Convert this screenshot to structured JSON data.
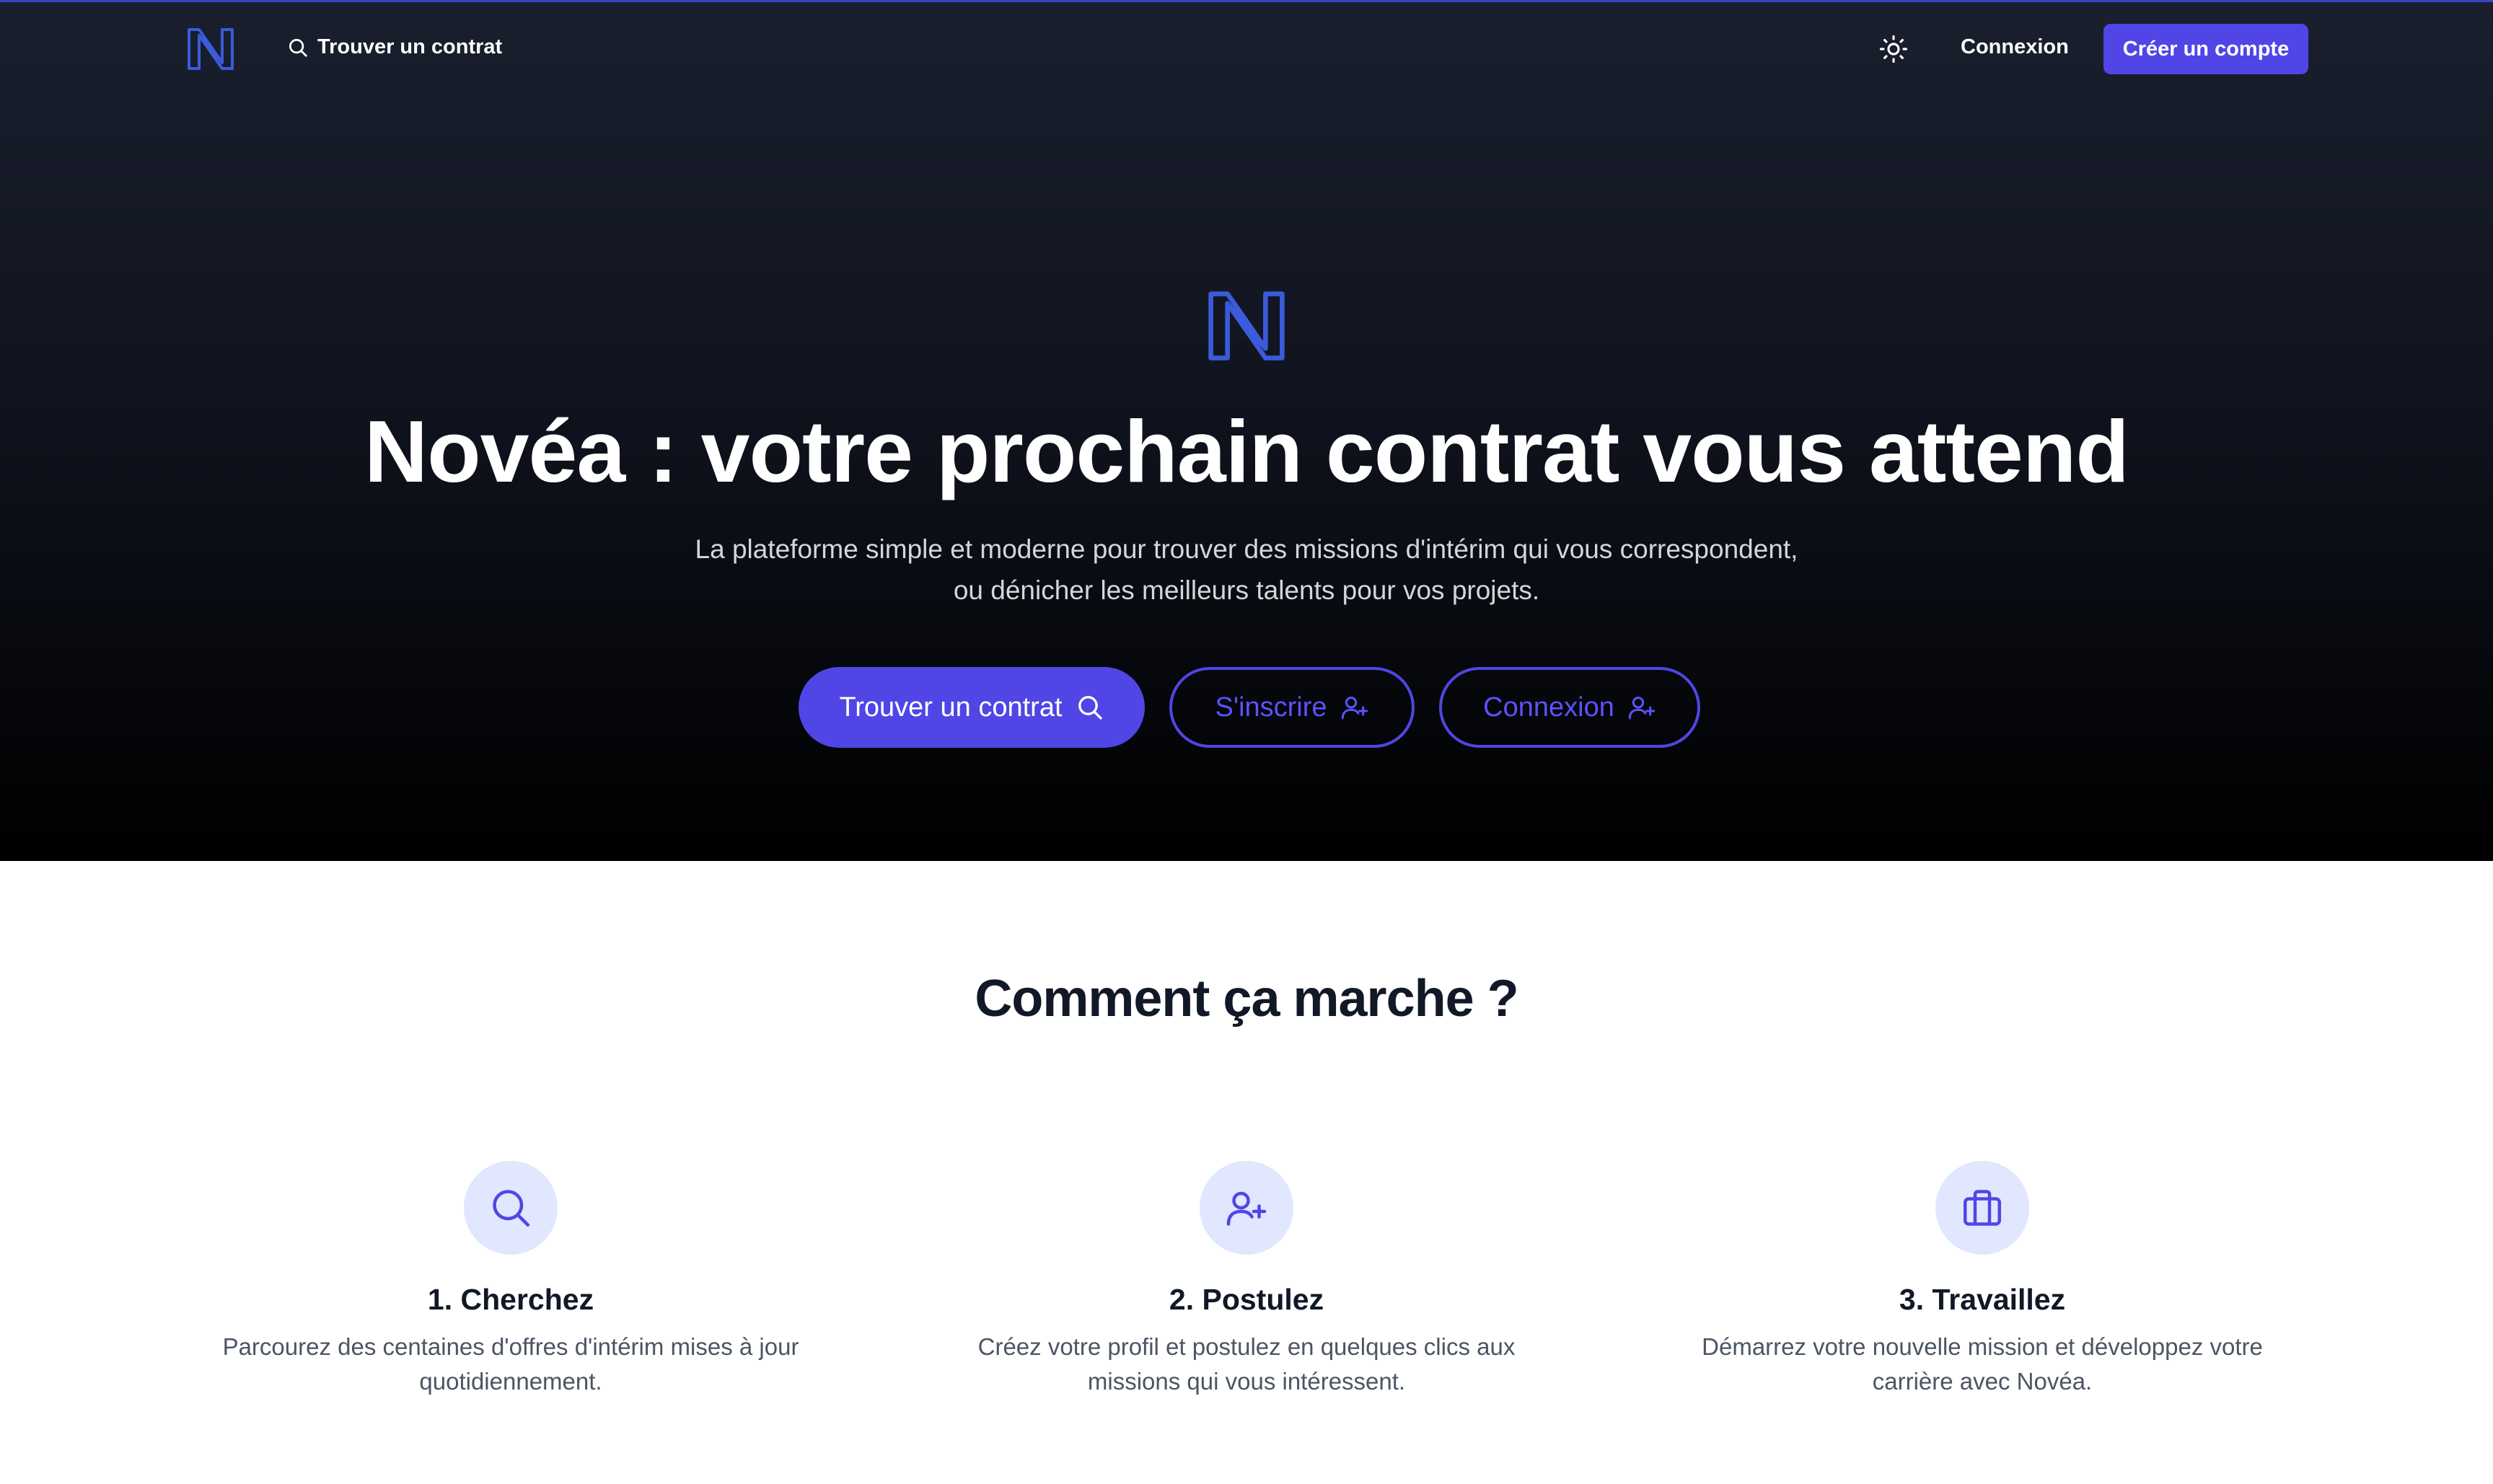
{
  "nav": {
    "search_label": "Trouver un contrat",
    "login_label": "Connexion",
    "signup_label": "Créer un compte",
    "icons": [
      "novea-logo-icon",
      "search-icon",
      "sun-icon"
    ]
  },
  "hero": {
    "title": "Novéa : votre prochain contrat vous attend",
    "subtitle_line1": "La plateforme simple et moderne pour trouver des missions d'intérim qui vous correspondent,",
    "subtitle_line2": "ou dénicher les meilleurs talents pour vos projets.",
    "buttons": {
      "find": "Trouver un contrat",
      "register": "S'inscrire",
      "login": "Connexion"
    }
  },
  "how": {
    "title": "Comment ça marche ?",
    "steps": [
      {
        "title": "1. Cherchez",
        "text": "Parcourez des centaines d'offres d'intérim mises à jour quotidiennement.",
        "icon": "search-icon"
      },
      {
        "title": "2. Postulez",
        "text": "Créez votre profil et postulez en quelques clics aux missions qui vous intéressent.",
        "icon": "user-plus-icon"
      },
      {
        "title": "3. Travaillez",
        "text": "Démarrez votre nouvelle mission et développez votre carrière avec Novéa.",
        "icon": "briefcase-icon"
      }
    ]
  },
  "colors": {
    "accent": "#4f46e5",
    "accent_text": "#5b52ff",
    "icon_bg": "#e0e7ff",
    "hero_top": "#1a1f2e",
    "hero_bottom": "#000000",
    "heading": "#111827",
    "body_text": "#4b5563"
  }
}
